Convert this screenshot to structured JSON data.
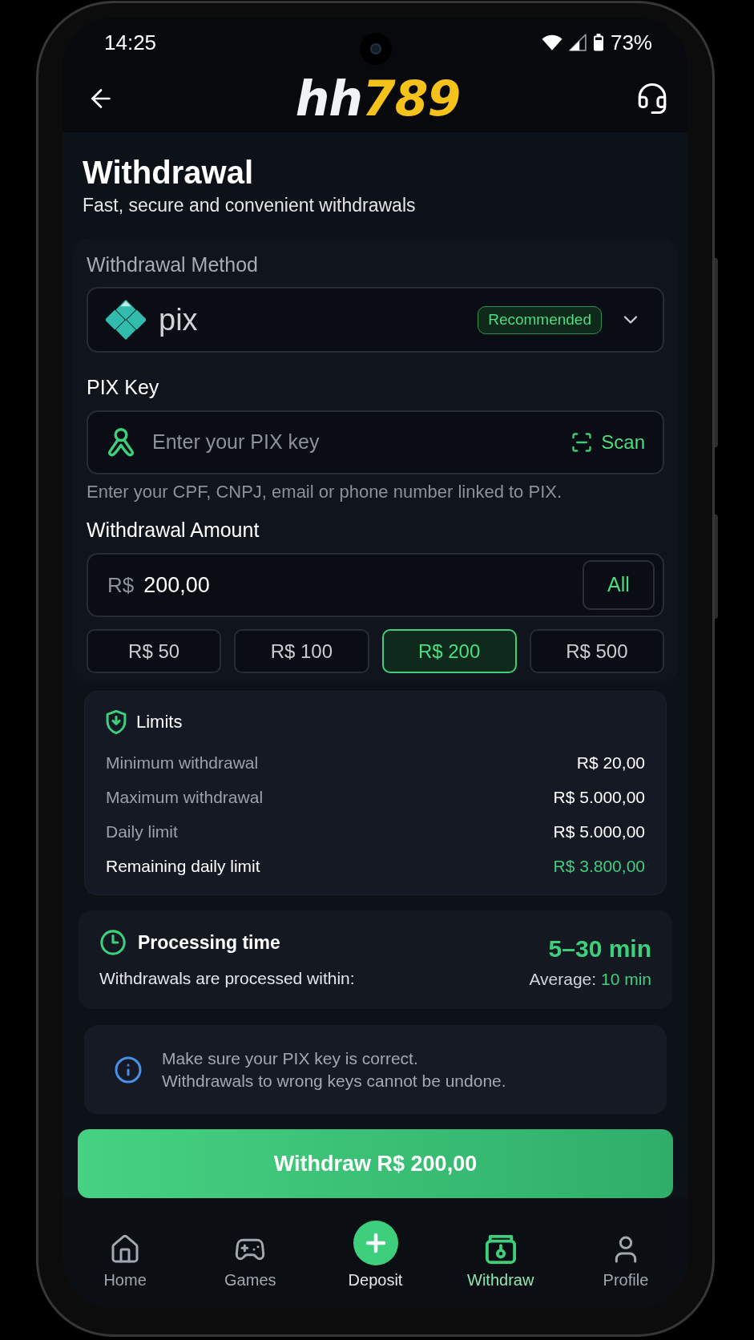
{
  "status_bar": {
    "time": "14:25",
    "battery": "73%"
  },
  "header": {
    "logo": {
      "prefix": "hh",
      "suffix": "789"
    }
  },
  "page": {
    "title": "Withdrawal",
    "subtitle": "Fast, secure and convenient withdrawals"
  },
  "withdrawal_method": {
    "label": "Withdrawal Method",
    "method": "pix",
    "badge": "Recommended"
  },
  "pix_key": {
    "label": "PIX Key",
    "placeholder": "Enter your PIX key",
    "scan_button": "Scan",
    "hint": "Enter your CPF, CNPJ, email or phone number linked to PIX."
  },
  "withdrawal_amount": {
    "label": "Withdrawal Amount",
    "currency": "R$",
    "value": "200,00",
    "all_button": "All",
    "presets": [
      {
        "label": "R$ 50",
        "selected": false
      },
      {
        "label": "R$ 100",
        "selected": false
      },
      {
        "label": "R$ 200",
        "selected": true
      },
      {
        "label": "R$ 500",
        "selected": false
      }
    ]
  },
  "limits": {
    "title": "Limits",
    "rows": [
      {
        "label": "Minimum withdrawal",
        "value": "R$ 20,00",
        "highlight": false
      },
      {
        "label": "Maximum withdrawal",
        "value": "R$ 5.000,00",
        "highlight": false
      },
      {
        "label": "Daily limit",
        "value": "R$ 5.000,00",
        "highlight": false
      },
      {
        "label": "Remaining daily limit",
        "value": "R$ 3.800,00",
        "highlight": true
      }
    ]
  },
  "processing": {
    "title": "Processing time",
    "range": "5–30 min",
    "description": "Withdrawals are processed within:",
    "average_label": "Average:",
    "average_value": "10 min"
  },
  "notice": {
    "lines": [
      "Make sure your PIX key is correct.",
      "Withdrawals to wrong keys cannot be undone."
    ]
  },
  "withdraw_button": "Withdraw R$ 200,00",
  "bottom_nav": [
    {
      "label": "Home",
      "kind": "tab",
      "selected": false
    },
    {
      "label": "Games",
      "kind": "tab",
      "selected": false
    },
    {
      "label": "Deposit",
      "kind": "action",
      "selected": false
    },
    {
      "label": "Withdraw",
      "kind": "tab",
      "selected": true
    },
    {
      "label": "Profile",
      "kind": "tab",
      "selected": false
    }
  ]
}
